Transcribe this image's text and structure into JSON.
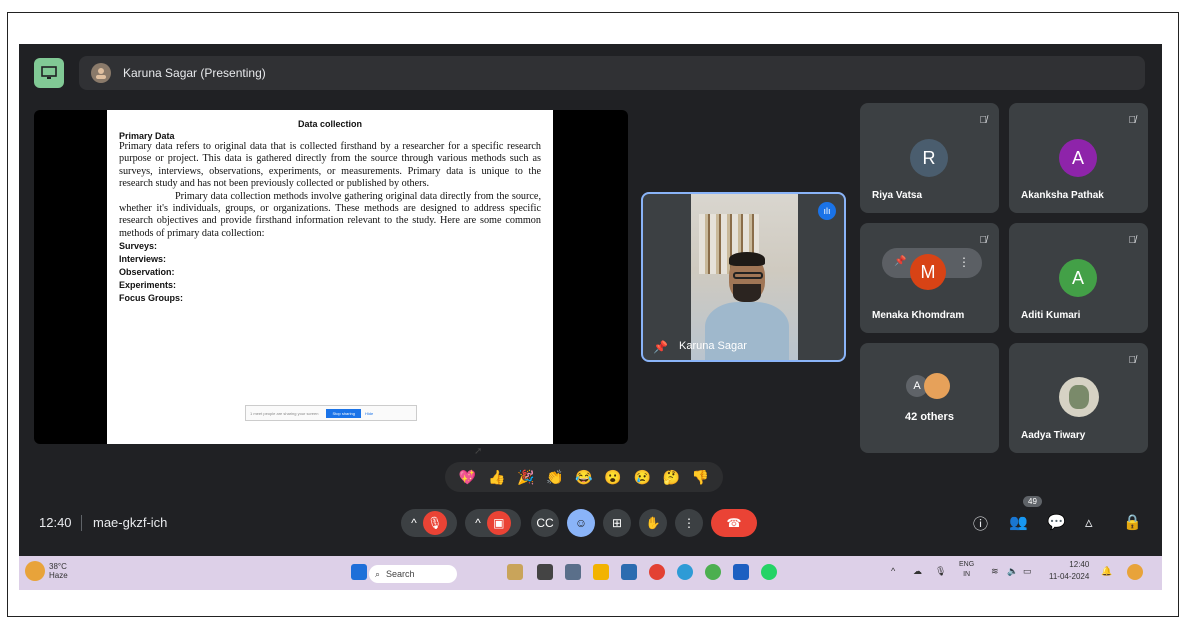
{
  "presenter": {
    "label": "Karuna Sagar (Presenting)"
  },
  "slide": {
    "title": "Data collection",
    "subtitle": "Primary Data",
    "para1": "Primary data refers to original data that is collected firsthand by a researcher for a specific research purpose or project. This data is gathered directly from the source through various methods such as surveys, interviews, observations, experiments, or measurements. Primary data is unique to the research study and has not been previously collected or published by others.",
    "para2": "Primary data collection methods involve gathering original data directly from the source, whether it's individuals, groups, or organizations. These methods are designed to address specific research objectives and provide firsthand information relevant to the study. Here are some common methods of primary data collection:",
    "methods": [
      "Surveys:",
      "Interviews:",
      "Observation:",
      "Experiments:",
      "Focus Groups:"
    ],
    "share_text": "1 meet people are sharing your screen",
    "stop_label": "Stop sharing",
    "hide_label": "Hide"
  },
  "speaker": {
    "name": "Karuna Sagar"
  },
  "participants": [
    {
      "name": "Riya Vatsa",
      "initial": "R",
      "color": "#4a5d6e"
    },
    {
      "name": "Akanksha Pathak",
      "initial": "A",
      "color": "#8e24aa"
    },
    {
      "name": "Menaka Khomdram",
      "initial": "M",
      "color": "#d84315"
    },
    {
      "name": "Aditi Kumari",
      "initial": "A",
      "color": "#43a047"
    },
    {
      "name": "42 others",
      "initial": "A",
      "color": "#5f6368"
    },
    {
      "name": "Aadya Tiwary",
      "initial": "",
      "color": "#7a8a6a"
    }
  ],
  "reactions": [
    "💖",
    "👍",
    "🎉",
    "👏",
    "😂",
    "😮",
    "😢",
    "🤔",
    "👎"
  ],
  "bottom": {
    "time": "12:40",
    "meeting_code": "mae-gkzf-ich",
    "participants_count": "49"
  },
  "taskbar": {
    "temp": "38°C",
    "weather": "Haze",
    "search": "Search",
    "lang": "ENG",
    "region": "IN",
    "clock_time": "12:40",
    "clock_date": "11-04-2024"
  }
}
